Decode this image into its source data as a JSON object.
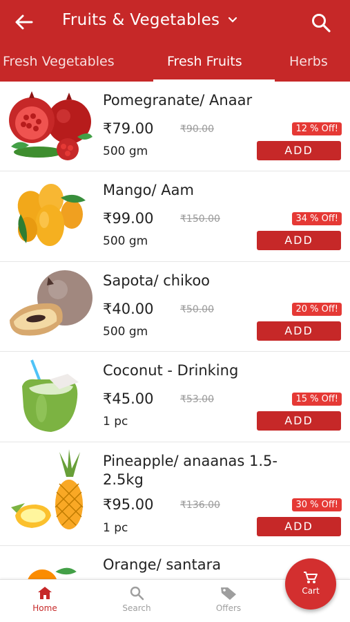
{
  "header": {
    "title": "Fruits & Vegetables"
  },
  "tabs": [
    {
      "label": "Fresh Vegetables"
    },
    {
      "label": "Fresh Fruits",
      "active": true
    },
    {
      "label": "Herbs"
    }
  ],
  "products": [
    {
      "name": "Pomegranate/ Anaar",
      "price": "₹79.00",
      "mrp": "₹90.00",
      "discount": "12 % Off!",
      "qty": "500 gm",
      "add_label": "ADD"
    },
    {
      "name": "Mango/ Aam",
      "price": "₹99.00",
      "mrp": "₹150.00",
      "discount": "34 % Off!",
      "qty": "500 gm",
      "add_label": "ADD"
    },
    {
      "name": "Sapota/ chikoo",
      "price": "₹40.00",
      "mrp": "₹50.00",
      "discount": "20 % Off!",
      "qty": "500 gm",
      "add_label": "ADD"
    },
    {
      "name": "Coconut - Drinking",
      "price": "₹45.00",
      "mrp": "₹53.00",
      "discount": "15 % Off!",
      "qty": "1 pc",
      "add_label": "ADD"
    },
    {
      "name": "Pineapple/ anaanas 1.5-2.5kg",
      "price": "₹95.00",
      "mrp": "₹136.00",
      "discount": "30 % Off!",
      "qty": "1 pc",
      "add_label": "ADD"
    },
    {
      "name": "Orange/ santara"
    }
  ],
  "bottom_nav": [
    {
      "label": "Home",
      "icon": "home-icon",
      "active": true
    },
    {
      "label": "Search",
      "icon": "search-icon"
    },
    {
      "label": "Offers",
      "icon": "tag-icon"
    }
  ],
  "cart": {
    "label": "Cart",
    "icon": "cart-icon"
  },
  "colors": {
    "primary": "#c62828",
    "discount_badge": "#e53935",
    "inactive_nav": "#9e9e9e"
  }
}
